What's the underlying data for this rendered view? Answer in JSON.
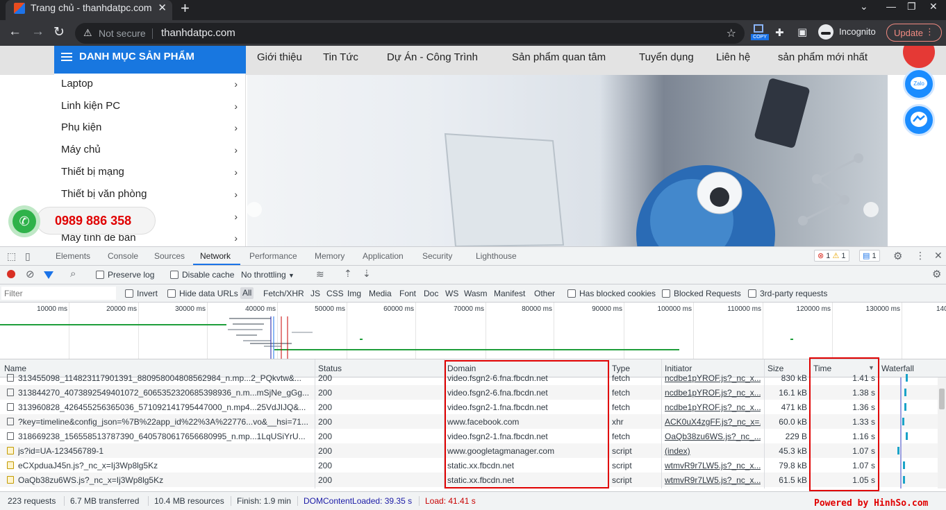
{
  "browser": {
    "tab_title": "Trang chủ - thanhdatpc.com",
    "not_secure_label": "Not secure",
    "url": "thanhdatpc.com",
    "copy_badge": "COPY",
    "incognito_label": "Incognito",
    "update_label": "Update"
  },
  "site": {
    "category_button": "DANH MỤC SẢN PHẨM",
    "nav": [
      "Giới thiệu",
      "Tin Tức",
      "Dự Án - Công Trình",
      "Sản phẩm quan tâm",
      "Tuyển dụng",
      "Liên hệ",
      "sản phẩm mới nhất"
    ],
    "categories": [
      "Laptop",
      "Linh kiện PC",
      "Phụ kiện",
      "Máy chủ",
      "Thiết bị mạng",
      "Thiết bị văn phòng",
      "Máy tính để bàn"
    ],
    "hotline": "0989 886 358",
    "zalo_label": "Zalo",
    "colors": {
      "brand_blue": "#1877e0",
      "hotline_red": "#e00000",
      "call_green": "#2fb24a"
    }
  },
  "devtools": {
    "tabs": [
      "Elements",
      "Console",
      "Sources",
      "Network",
      "Performance",
      "Memory",
      "Application",
      "Security",
      "Lighthouse"
    ],
    "active_tab": "Network",
    "badges": {
      "errors": "1",
      "warnings": "1",
      "messages": "1"
    },
    "toolbar": {
      "preserve_log": "Preserve log",
      "disable_cache": "Disable cache",
      "throttling": "No throttling"
    },
    "filter": {
      "placeholder": "Filter",
      "invert": "Invert",
      "hide_data_urls": "Hide data URLs",
      "types": [
        "All",
        "Fetch/XHR",
        "JS",
        "CSS",
        "Img",
        "Media",
        "Font",
        "Doc",
        "WS",
        "Wasm",
        "Manifest",
        "Other"
      ],
      "has_blocked_cookies": "Has blocked cookies",
      "blocked_requests": "Blocked Requests",
      "third_party": "3rd-party requests"
    },
    "timeline_ticks": [
      "10000 ms",
      "20000 ms",
      "30000 ms",
      "40000 ms",
      "50000 ms",
      "60000 ms",
      "70000 ms",
      "80000 ms",
      "90000 ms",
      "100000 ms",
      "110000 ms",
      "120000 ms",
      "130000 ms",
      "140"
    ],
    "columns": [
      "Name",
      "Status",
      "Domain",
      "Type",
      "Initiator",
      "Size",
      "Time",
      "Waterfall"
    ],
    "rows": [
      {
        "name": "313455098_114823117901391_880958004808562984_n.mp...2_PQkvtw&...",
        "status": "200",
        "domain": "video.fsgn2-6.fna.fbcdn.net",
        "type": "fetch",
        "initiator": "ncdbe1pYROF.js?_nc_x...",
        "size": "830 kB",
        "time": "1.41 s",
        "js": false
      },
      {
        "name": "313844270_4073892549401072_6065352320685398936_n.m...mSjNe_gGg...",
        "status": "200",
        "domain": "video.fsgn2-6.fna.fbcdn.net",
        "type": "fetch",
        "initiator": "ncdbe1pYROF.js?_nc_x...",
        "size": "16.1 kB",
        "time": "1.38 s",
        "js": false
      },
      {
        "name": "313960828_426455256365036_5710921417954470​00_n.mp4...25VdJIJQ&...",
        "status": "200",
        "domain": "video.fsgn2-1.fna.fbcdn.net",
        "type": "fetch",
        "initiator": "ncdbe1pYROF.js?_nc_x...",
        "size": "471 kB",
        "time": "1.36 s",
        "js": false
      },
      {
        "name": "?key=timeline&config_json=%7B%22app_id%22%3A%22776...vo&__hsi=71...",
        "status": "200",
        "domain": "www.facebook.com",
        "type": "xhr",
        "initiator": "ACK0uX4zgFF.js?_nc_x=...",
        "size": "60.0 kB",
        "time": "1.33 s",
        "js": false
      },
      {
        "name": "318669238_156558513787390_6405780617656680995_n.mp...1LqUSiYrU...",
        "status": "200",
        "domain": "video.fsgn2-1.fna.fbcdn.net",
        "type": "fetch",
        "initiator": "OaQb38zu6WS.js?_nc_...",
        "size": "229 B",
        "time": "1.16 s",
        "js": false
      },
      {
        "name": "js?id=UA-123456789-1",
        "status": "200",
        "domain": "www.googletagmanager.com",
        "type": "script",
        "initiator": "(index)",
        "size": "45.3 kB",
        "time": "1.07 s",
        "js": true
      },
      {
        "name": "eCXpduaJ45n.js?_nc_x=Ij3Wp8lg5Kz",
        "status": "200",
        "domain": "static.xx.fbcdn.net",
        "type": "script",
        "initiator": "wtmvR9r7LW5.js?_nc_x...",
        "size": "79.8 kB",
        "time": "1.07 s",
        "js": true
      },
      {
        "name": "OaQb38zu6WS.js?_nc_x=Ij3Wp8lg5Kz",
        "status": "200",
        "domain": "static.xx.fbcdn.net",
        "type": "script",
        "initiator": "wtmvR9r7LW5.js?_nc_x...",
        "size": "61.5 kB",
        "time": "1.05 s",
        "js": true
      }
    ],
    "status_bar": {
      "requests": "223 requests",
      "transferred": "6.7 MB transferred",
      "resources": "10.4 MB resources",
      "finish": "Finish: 1.9 min",
      "dom_content_loaded": "DOMContentLoaded: 39.35 s",
      "load": "Load: 41.41 s"
    },
    "colors": {
      "accent": "#1a73e8",
      "dcl": "#1a1aa6",
      "load": "#c80000",
      "highlight_box": "#e00000"
    }
  },
  "watermark": "Powered by HinhSo.com"
}
